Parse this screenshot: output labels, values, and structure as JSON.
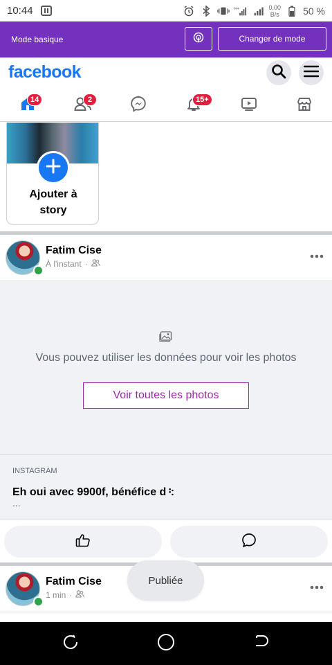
{
  "status_bar": {
    "time": "10:44",
    "net_speed_value": "0.00",
    "net_speed_unit": "B/s",
    "battery": "50 %",
    "icons": [
      "nfc-icon",
      "alarm-icon",
      "bluetooth-icon",
      "vibrate-icon",
      "signal-h-plus-icon",
      "signal-icon",
      "battery-icon"
    ]
  },
  "mode_bar": {
    "label": "Mode basique",
    "switch_label": "Changer de mode",
    "color": "#7431bd"
  },
  "header": {
    "logo": "facebook",
    "brand_color": "#1877f2"
  },
  "tabs": [
    {
      "name": "home",
      "badge": "14"
    },
    {
      "name": "friends",
      "badge": "2"
    },
    {
      "name": "messenger",
      "badge": ""
    },
    {
      "name": "notifications",
      "badge": "15+"
    },
    {
      "name": "watch",
      "badge": ""
    },
    {
      "name": "marketplace",
      "badge": ""
    }
  ],
  "story": {
    "add_label_line1": "Ajouter à",
    "add_label_line2": "story"
  },
  "post1": {
    "author": "Fatim Cise",
    "time": "À l'instant",
    "placeholder_text": "Vous pouvez utiliser les données pour voir les photos",
    "view_photos_button": "Voir toutes les photos",
    "link_source": "INSTAGRAM",
    "link_title": "Eh oui avec 9900f, bénéfice d᠄:",
    "link_desc": "..."
  },
  "post2": {
    "author": "Fatim Cise",
    "time": "1 min"
  },
  "toast": {
    "text": "Publiée"
  }
}
